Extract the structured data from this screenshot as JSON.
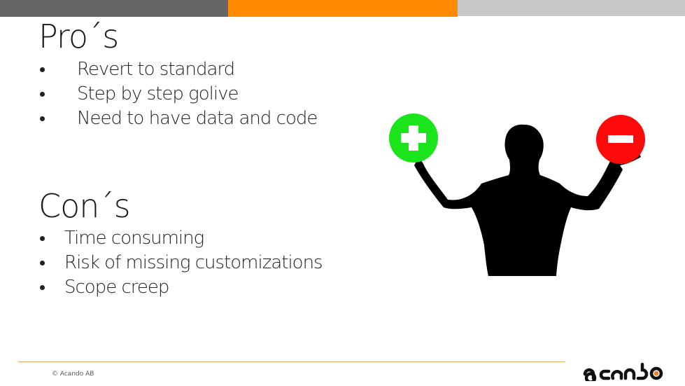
{
  "colors": {
    "topbar": [
      "#666666",
      "#ff8a00",
      "#c8c8c8"
    ],
    "accent": "#ff8a00",
    "plus": "#1be41b",
    "minus": "#ff0a0a"
  },
  "pros": {
    "title": "Pro´s",
    "items": [
      "Revert to standard",
      "Step by step golive",
      "Need to have data and code"
    ]
  },
  "cons": {
    "title": "Con´s",
    "items": [
      "Time consuming",
      "Risk of missing customizations",
      "Scope creep"
    ]
  },
  "illustration": {
    "description": "silhouette-balancing-plus-and-minus",
    "left_icon": "plus-icon",
    "right_icon": "minus-icon"
  },
  "footer": {
    "copyright": "© Acando AB",
    "logo_text": "acando"
  }
}
